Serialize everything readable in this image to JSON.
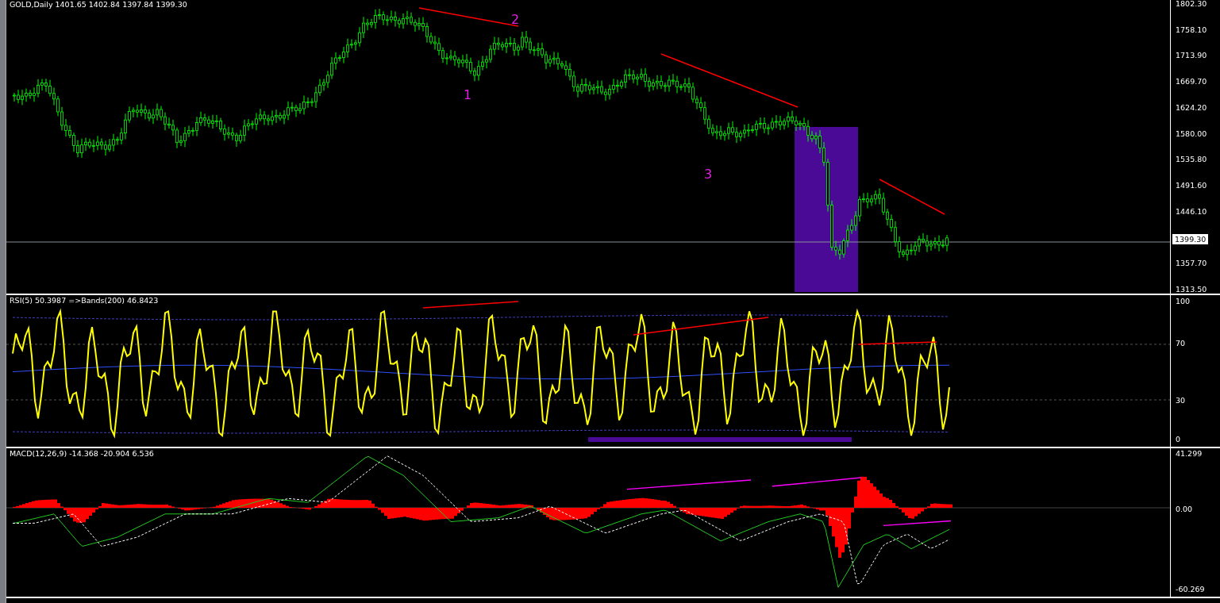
{
  "price_panel": {
    "title": "GOLD,Daily  1401.65 1402.84 1397.84 1399.30",
    "axis_labels": [
      "1802.30",
      "1758.10",
      "1713.90",
      "1669.70",
      "1624.20",
      "1580.00",
      "1535.80",
      "1491.60",
      "1446.10",
      "1357.70",
      "1313.50"
    ],
    "current_price": "1399.30",
    "annotations": [
      "1",
      "2",
      "3"
    ]
  },
  "rsi_panel": {
    "title": "RSI(5) 50.3987  =>Bands(200) 46.8423",
    "axis_labels": [
      "100",
      "70",
      "30",
      "0"
    ]
  },
  "macd_panel": {
    "title": "MACD(12,26,9) -14.368 -20.904 6.536",
    "axis_labels": [
      "41.299",
      "0.00",
      "-60.269"
    ]
  }
}
